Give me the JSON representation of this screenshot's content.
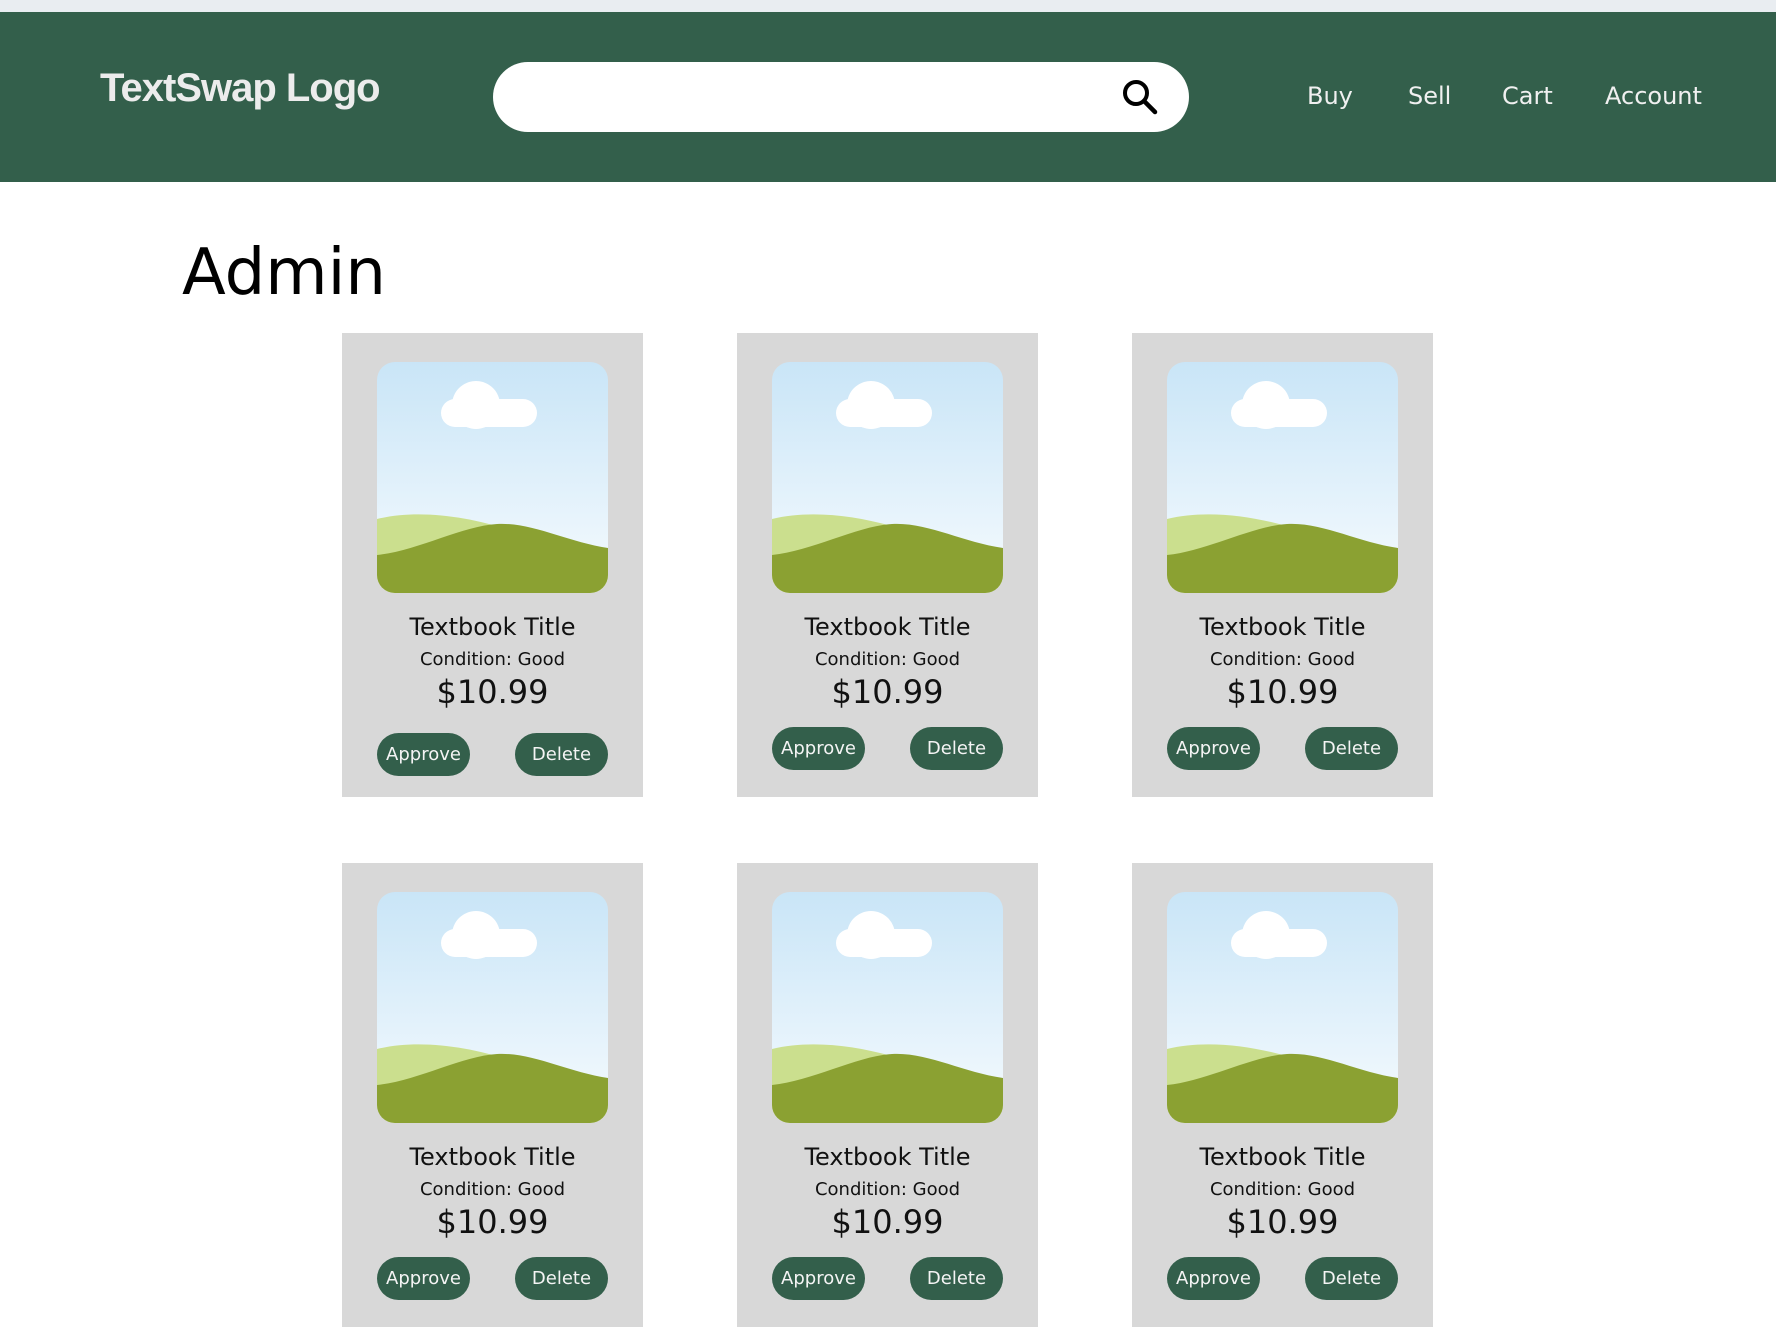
{
  "header": {
    "logo": "TextSwap Logo",
    "search": {
      "placeholder": "",
      "value": ""
    },
    "nav": [
      "Buy",
      "Sell",
      "Cart",
      "Account"
    ]
  },
  "page": {
    "title": "Admin"
  },
  "listings": [
    {
      "title": "Textbook Title",
      "condition": "Condition: Good",
      "price": "$10.99",
      "approve": "Approve",
      "delete": "Delete"
    },
    {
      "title": "Textbook Title",
      "condition": "Condition: Good",
      "price": "$10.99",
      "approve": "Approve",
      "delete": "Delete"
    },
    {
      "title": "Textbook Title",
      "condition": "Condition: Good",
      "price": "$10.99",
      "approve": "Approve",
      "delete": "Delete"
    },
    {
      "title": "Textbook Title",
      "condition": "Condition: Good",
      "price": "$10.99",
      "approve": "Approve",
      "delete": "Delete"
    },
    {
      "title": "Textbook Title",
      "condition": "Condition: Good",
      "price": "$10.99",
      "approve": "Approve",
      "delete": "Delete"
    },
    {
      "title": "Textbook Title",
      "condition": "Condition: Good",
      "price": "$10.99",
      "approve": "Approve",
      "delete": "Delete"
    }
  ],
  "colors": {
    "header_bg": "#335f4b",
    "button_bg": "#335f4b",
    "card_bg": "#d8d8d8"
  },
  "icons": {
    "search": "search-icon",
    "thumbnail": "image-placeholder-icon"
  }
}
